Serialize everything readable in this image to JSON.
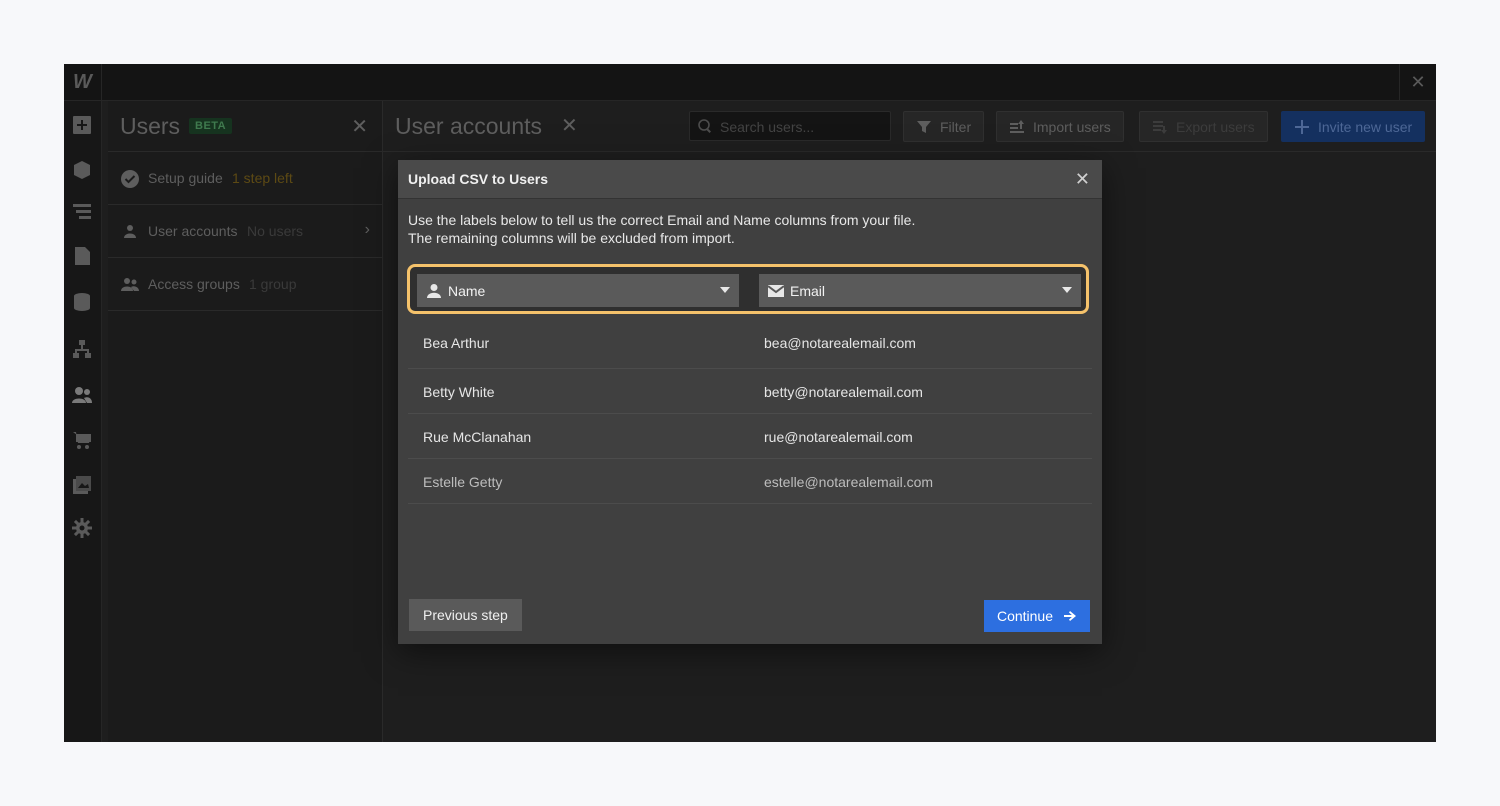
{
  "app": {
    "logo": "W",
    "close_glyph": "✕"
  },
  "rail": {
    "icons": [
      "add-icon",
      "cube-icon",
      "navigator-icon",
      "pages-icon",
      "database-icon",
      "logic-icon",
      "users-icon",
      "ecommerce-icon",
      "assets-icon",
      "settings-icon"
    ]
  },
  "panel": {
    "title": "Users",
    "badge": "BETA",
    "items": [
      {
        "label": "Setup guide",
        "sub": "1 step left"
      },
      {
        "label": "User accounts",
        "sub": "No users"
      },
      {
        "label": "Access groups",
        "sub": "1 group"
      }
    ]
  },
  "main": {
    "title": "User accounts",
    "search_placeholder": "Search users...",
    "filter_label": "Filter",
    "import_label": "Import users",
    "export_label": "Export users",
    "invite_label": "Invite new user"
  },
  "modal": {
    "title": "Upload CSV to Users",
    "desc_line1": "Use the labels below to tell us the correct Email and Name columns from your file.",
    "desc_line2": "The remaining columns will be excluded from import.",
    "col1_select": "Name",
    "col2_select": "Email",
    "rows": [
      {
        "name": "Bea Arthur",
        "email": "bea@notarealemail.com"
      },
      {
        "name": "Betty White",
        "email": "betty@notarealemail.com"
      },
      {
        "name": "Rue McClanahan",
        "email": "rue@notarealemail.com"
      },
      {
        "name": "Estelle Getty",
        "email": "estelle@notarealemail.com"
      }
    ],
    "prev_label": "Previous step",
    "continue_label": "Continue"
  },
  "colors": {
    "highlight": "#f5c26b",
    "primary": "#2d6fe0",
    "modal_bg": "#404040"
  }
}
